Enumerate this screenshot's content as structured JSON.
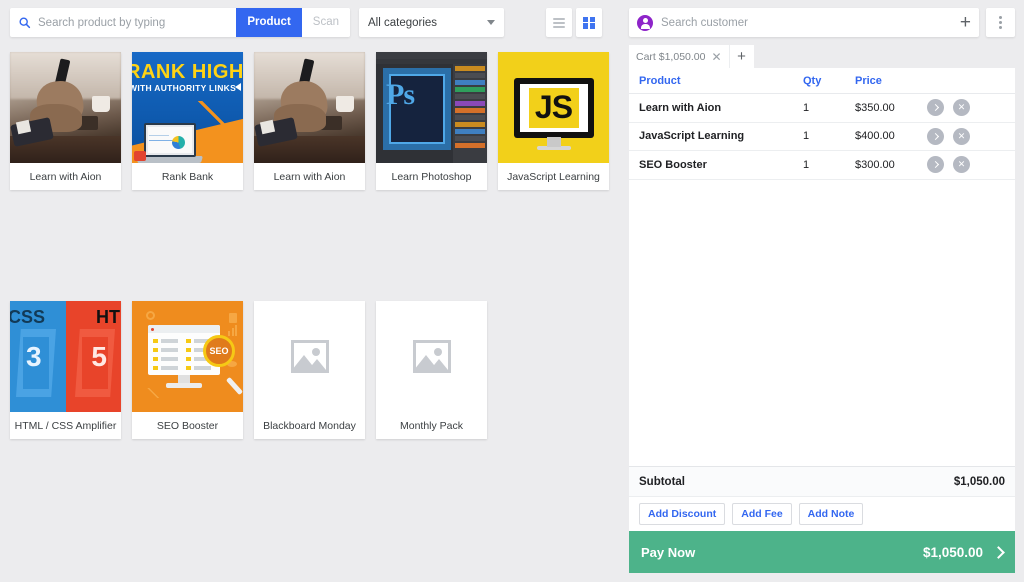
{
  "toolbar": {
    "search_placeholder": "Search product by typing",
    "search_value": "",
    "mode_product": "Product",
    "mode_scan": "Scan",
    "category_selected": "All categories",
    "search_icon": "search-icon",
    "list_view_icon": "list-view-icon",
    "grid_view_icon": "grid-view-icon"
  },
  "products": {
    "row1": [
      {
        "label": "Learn with Aion",
        "thumb": "photo-hand-phone"
      },
      {
        "label": "Rank Bank",
        "thumb": "rank-higher-banner"
      },
      {
        "label": "Learn with Aion",
        "thumb": "photo-hand-phone"
      },
      {
        "label": "Learn Photoshop",
        "thumb": "photoshop-screenshot"
      },
      {
        "label": "JavaScript Learning",
        "thumb": "javascript-monitor"
      }
    ],
    "row2": [
      {
        "label": "HTML / CSS Amplifier",
        "thumb": "html-css-logos"
      },
      {
        "label": "SEO Booster",
        "thumb": "seo-magnifier"
      },
      {
        "label": "Blackboard Monday",
        "thumb": "image-placeholder"
      },
      {
        "label": "Monthly Pack",
        "thumb": "image-placeholder"
      }
    ]
  },
  "customer": {
    "placeholder": "Search customer",
    "avatar_icon": "customer-avatar-icon",
    "add_label": "+",
    "menu_icon": "more-vertical-icon"
  },
  "cart_tab": {
    "label": "Cart $1,050.00",
    "close_icon": "close-icon",
    "add_label": "+"
  },
  "cart": {
    "columns": {
      "product": "Product",
      "qty": "Qty",
      "price": "Price"
    },
    "items": [
      {
        "product": "Learn with Aion",
        "qty": "1",
        "price": "$350.00"
      },
      {
        "product": "JavaScript Learning",
        "qty": "1",
        "price": "$400.00"
      },
      {
        "product": "SEO Booster",
        "qty": "1",
        "price": "$300.00"
      }
    ],
    "subtotal_label": "Subtotal",
    "subtotal_value": "$1,050.00",
    "actions": {
      "add_discount": "Add Discount",
      "add_fee": "Add Fee",
      "add_note": "Add Note"
    },
    "pay_label": "Pay Now",
    "pay_amount": "$1,050.00"
  },
  "colors": {
    "accent_blue": "#3367f0",
    "pay_green": "#4db38a",
    "avatar_purple": "#8e24c9",
    "page_bg": "#ececee"
  }
}
